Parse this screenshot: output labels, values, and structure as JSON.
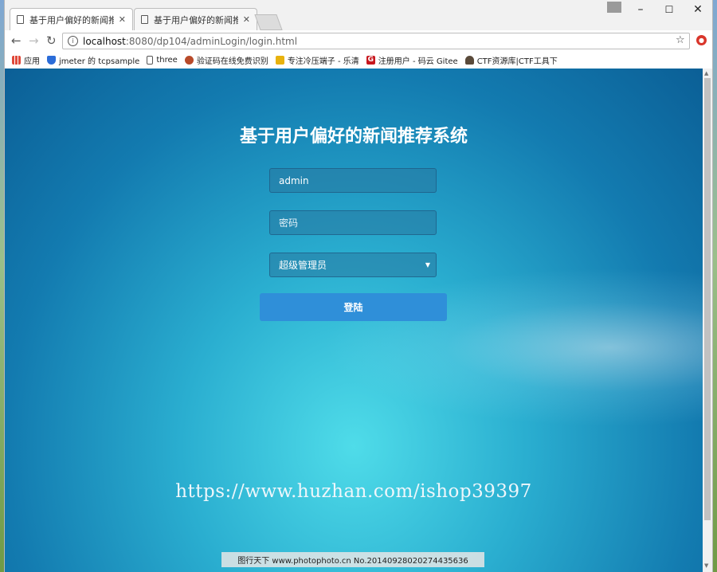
{
  "browser": {
    "tabs": [
      {
        "title": "基于用户偏好的新闻推荐",
        "active": true
      },
      {
        "title": "基于用户偏好的新闻推荐",
        "active": false
      }
    ],
    "url_host": "localhost",
    "url_path": ":8080/dp104/adminLogin/login.html",
    "bookmarks": [
      {
        "label": "应用",
        "icon": "apps-grid-icon",
        "color": "#e0493a"
      },
      {
        "label": "jmeter 的 tcpsample",
        "icon": "shield-icon",
        "color": "#2b6cd8"
      },
      {
        "label": "three",
        "icon": "page-icon",
        "color": "#777777"
      },
      {
        "label": "验证码在线免费识别",
        "icon": "bug-icon",
        "color": "#b84a2a"
      },
      {
        "label": "专注冷压端子 - 乐清",
        "icon": "badge-icon",
        "color": "#e8b20e"
      },
      {
        "label": "注册用户 - 码云 Gitee",
        "icon": "gitee-icon",
        "color": "#c7171e"
      },
      {
        "label": "CTF资源库|CTF工具下",
        "icon": "user-icon",
        "color": "#5a4a3a"
      }
    ]
  },
  "login": {
    "title": "基于用户偏好的新闻推荐系统",
    "username_value": "admin",
    "password_placeholder": "密码",
    "role_selected": "超级管理员",
    "submit_label": "登陆"
  },
  "overlay": {
    "watermark": "https://www.huzhan.com/ishop39397",
    "photo_credit": "图行天下 www.photophoto.cn No.20140928020274435636"
  }
}
